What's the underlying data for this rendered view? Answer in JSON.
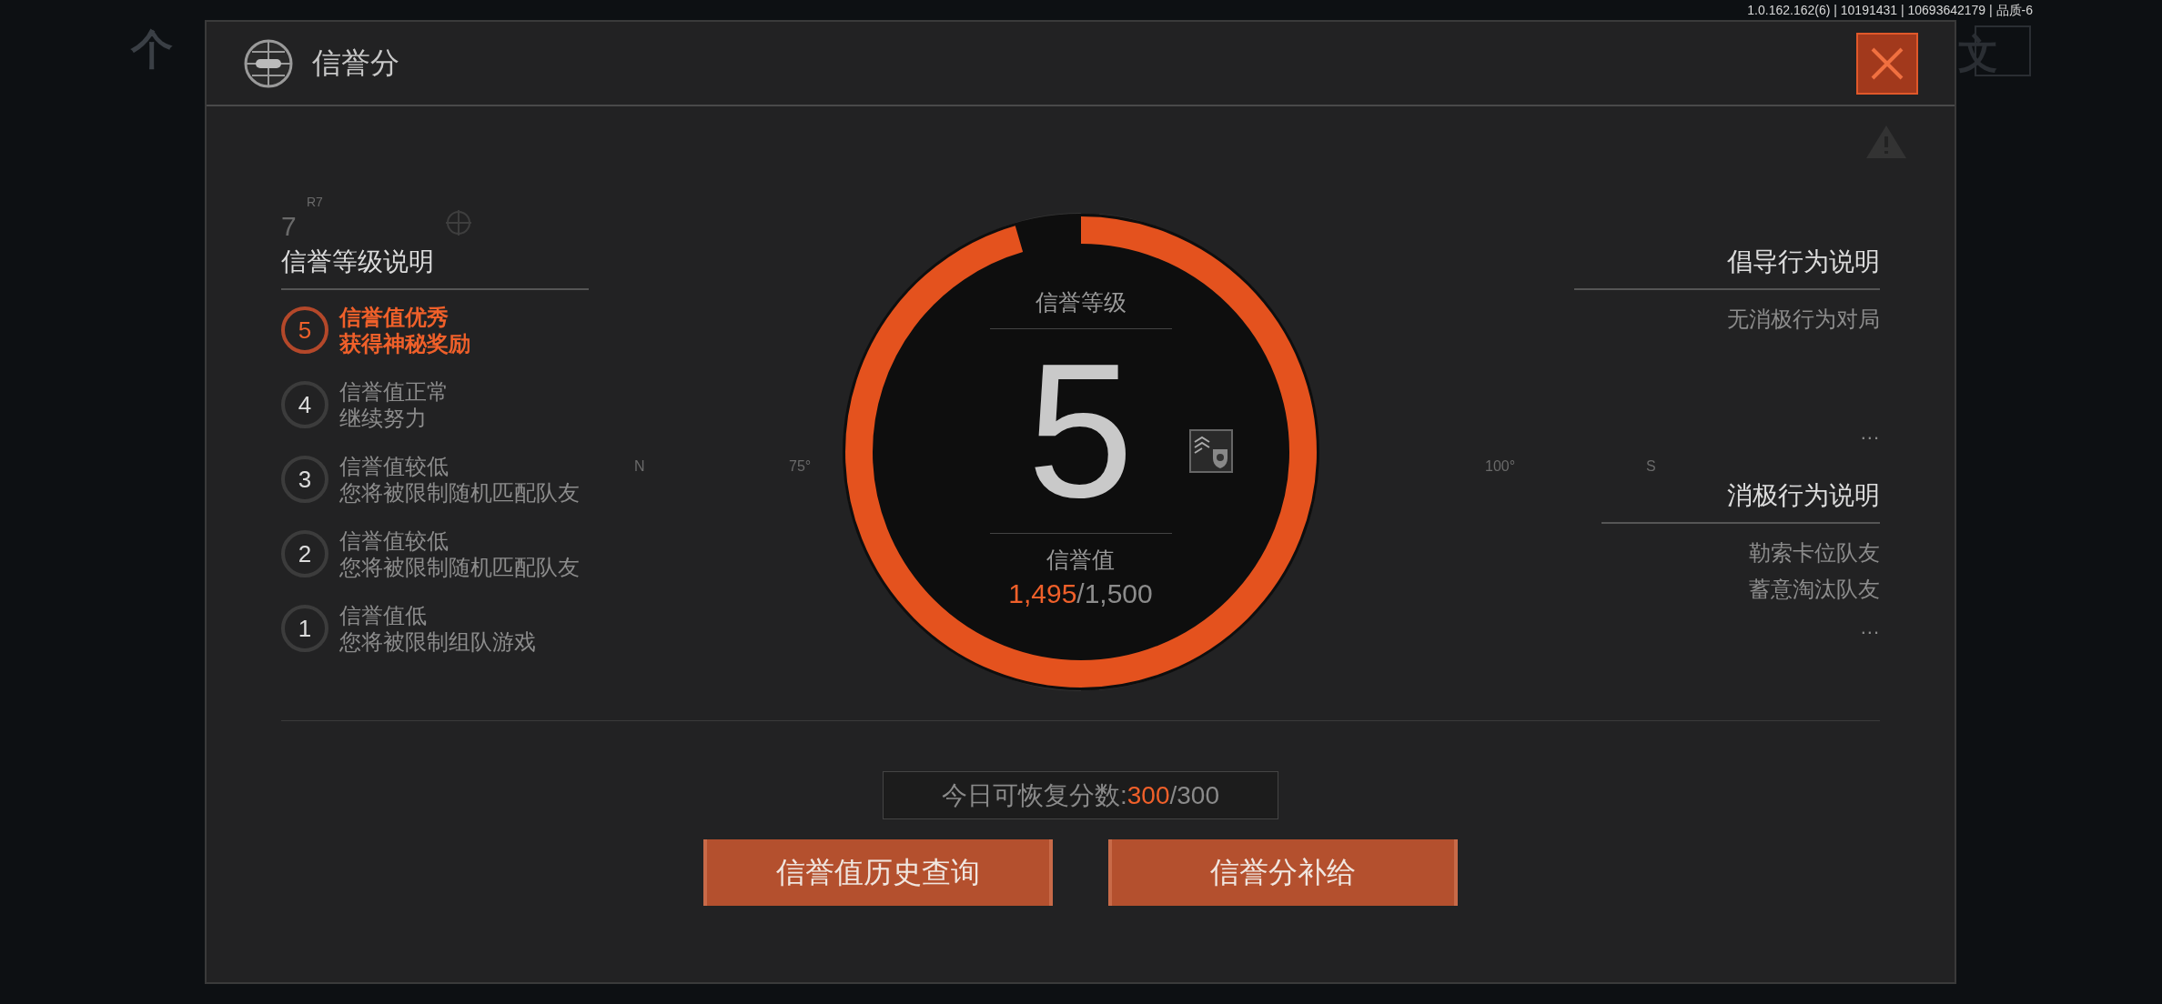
{
  "background": {
    "page_title": "个",
    "corner_label": "文"
  },
  "version": "1.0.162.162(6) | 10191431 | 10693642179 | 品质-6",
  "modal": {
    "title": "信誉分"
  },
  "markings": [
    "7",
    "R7",
    "N",
    "75°",
    "100°",
    "S"
  ],
  "levels": {
    "heading": "信誉等级说明",
    "items": [
      {
        "number": "5",
        "title": "信誉值优秀",
        "desc": "获得神秘奖励",
        "selected": true
      },
      {
        "number": "4",
        "title": "信誉值正常",
        "desc": "继续努力",
        "selected": false
      },
      {
        "number": "3",
        "title": "信誉值较低",
        "desc": "您将被限制随机匹配队友",
        "selected": false
      },
      {
        "number": "2",
        "title": "信誉值较低",
        "desc": "您将被限制随机匹配队友",
        "selected": false
      },
      {
        "number": "1",
        "title": "信誉值低",
        "desc": "您将被限制组队游戏",
        "selected": false
      }
    ]
  },
  "gauge": {
    "label": "信誉等级",
    "grade": "5",
    "level": 0.955,
    "score_label": "信誉值",
    "score": "1,495",
    "score_max": "/1,500"
  },
  "encouraged": {
    "heading": "倡导行为说明",
    "items": [
      "无消极行为对局"
    ],
    "more": "..."
  },
  "negative": {
    "heading": "消极行为说明",
    "items": [
      "勒索卡位队友",
      "蓄意淘汰队友"
    ],
    "more": "..."
  },
  "recovery": {
    "label": "今日可恢复分数:",
    "current": "300",
    "max": "/300"
  },
  "buttons": [
    "信誉值历史查询",
    "信誉分补给"
  ]
}
